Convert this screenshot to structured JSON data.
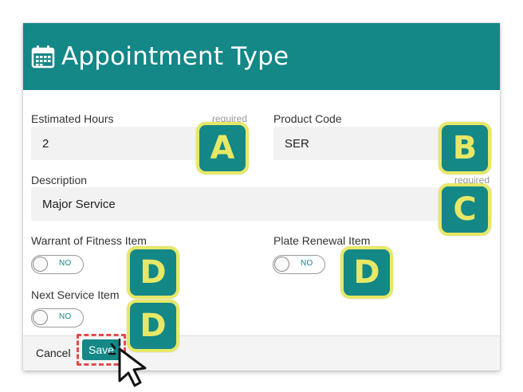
{
  "dialog": {
    "title": "Appointment Type",
    "icon": "calendar-icon"
  },
  "fields": {
    "estimated_hours": {
      "label": "Estimated Hours",
      "required": "required",
      "value": "2"
    },
    "product_code": {
      "label": "Product Code",
      "value": "SER"
    },
    "description": {
      "label": "Description",
      "required": "required",
      "value": "Major Service"
    }
  },
  "toggles": {
    "warrant_of_fitness": {
      "label": "Warrant of Fitness Item",
      "state": "NO"
    },
    "plate_renewal": {
      "label": "Plate Renewal Item",
      "state": "NO"
    },
    "next_service": {
      "label": "Next Service Item",
      "state": "NO"
    }
  },
  "footer": {
    "cancel_label": "Cancel",
    "save_label": "Save"
  },
  "annotations": {
    "a": "A",
    "b": "B",
    "c": "C",
    "d1": "D",
    "d2": "D",
    "d3": "D"
  },
  "colors": {
    "accent": "#148787",
    "badge_border": "#e6e866",
    "highlight": "#e24b4b"
  }
}
